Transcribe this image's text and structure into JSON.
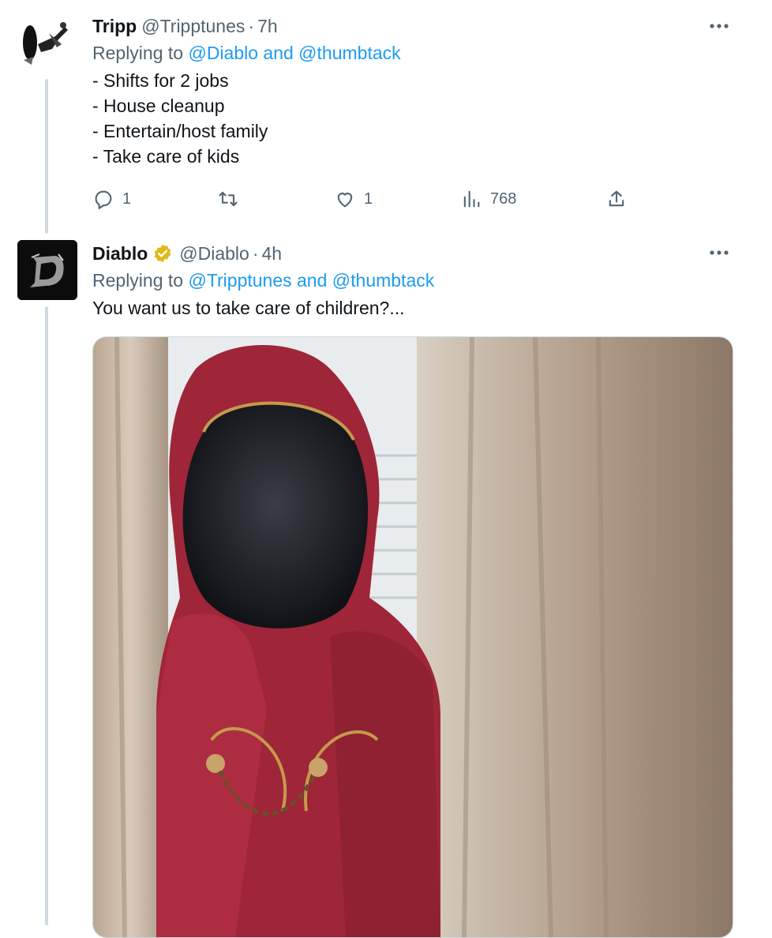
{
  "colors": {
    "link": "#1d9bf0",
    "secondary": "#536471",
    "text": "#0f1419",
    "verified": "#e2b719"
  },
  "tweets": [
    {
      "name": "Tripp",
      "handle": "@Tripptunes",
      "dot": "·",
      "time": "7h",
      "replying_prefix": "Replying to",
      "replying_to": "@Diablo and @thumbtack",
      "lines": [
        "- Shifts for 2 jobs",
        "- House cleanup",
        "- Entertain/host family",
        "- Take care of kids"
      ],
      "replies": "1",
      "retweets": "",
      "likes": "1",
      "views": "768",
      "icons": [
        "reply-icon",
        "retweet-icon",
        "like-icon",
        "views-icon",
        "share-icon",
        "more-icon"
      ]
    },
    {
      "name": "Diablo",
      "handle": "@Diablo",
      "dot": "·",
      "time": "4h",
      "replying_prefix": "Replying to",
      "replying_to": "@Tripptunes and @thumbtack",
      "lines": [
        "You want us to take care of children?..."
      ],
      "avatar_letter": "D",
      "icons": [
        "verified-badge-icon",
        "more-icon"
      ]
    }
  ]
}
